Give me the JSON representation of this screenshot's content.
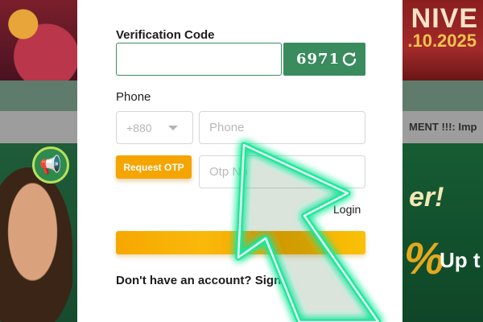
{
  "background": {
    "banner_top_right_text": "NIVE",
    "banner_top_right_date": ".10.2025",
    "marquee_text": "MENT !!!: Imp",
    "promo_text_1": "er!",
    "promo_text_2": "%",
    "promo_text_3": "Up t",
    "megaphone_icon": "megaphone-icon"
  },
  "form": {
    "verification_label": "Verification Code",
    "verification_value": "",
    "captcha_code": "6971",
    "refresh_icon": "refresh-icon",
    "phone_label": "Phone",
    "country_code": "+880",
    "phone_placeholder": "Phone",
    "request_otp_label": "Request OTP",
    "otp_placeholder": "Otp No",
    "login_link": "Login",
    "signup_prompt": "Don't have an account? Sign"
  },
  "colors": {
    "accent_green": "#3a8b5d",
    "accent_orange": "#f4a500",
    "arrow_glow": "#1fe89a"
  }
}
